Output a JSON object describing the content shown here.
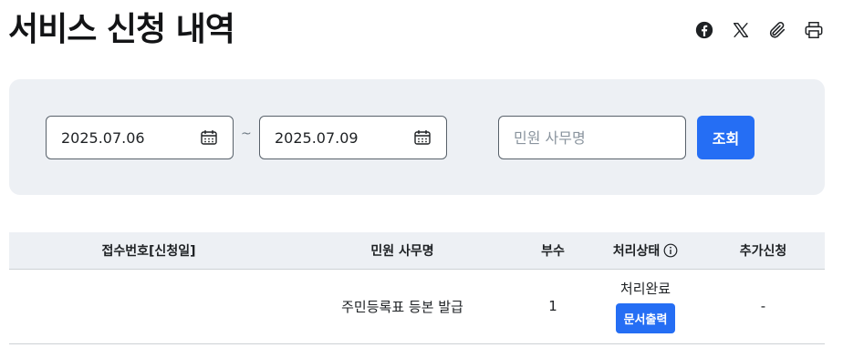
{
  "page": {
    "title": "서비스 신청 내역"
  },
  "share": {
    "icons": [
      "facebook-icon",
      "x-icon",
      "paperclip-icon",
      "print-icon"
    ]
  },
  "search": {
    "date_from": "2025.07.06",
    "date_to": "2025.07.09",
    "separator": "~",
    "name_placeholder": "민원 사무명",
    "search_label": "조회"
  },
  "table": {
    "headers": {
      "receipt": "접수번호[신청일]",
      "name": "민원 사무명",
      "copies": "부수",
      "status": "처리상태",
      "extra": "추가신청"
    },
    "rows": [
      {
        "receipt": "",
        "name": "주민등록표 등본 발급",
        "copies": "1",
        "status": "처리완료",
        "print_label": "문서출력",
        "extra": "-"
      }
    ]
  },
  "colors": {
    "accent": "#256ef4",
    "panel": "#edf0f4"
  }
}
